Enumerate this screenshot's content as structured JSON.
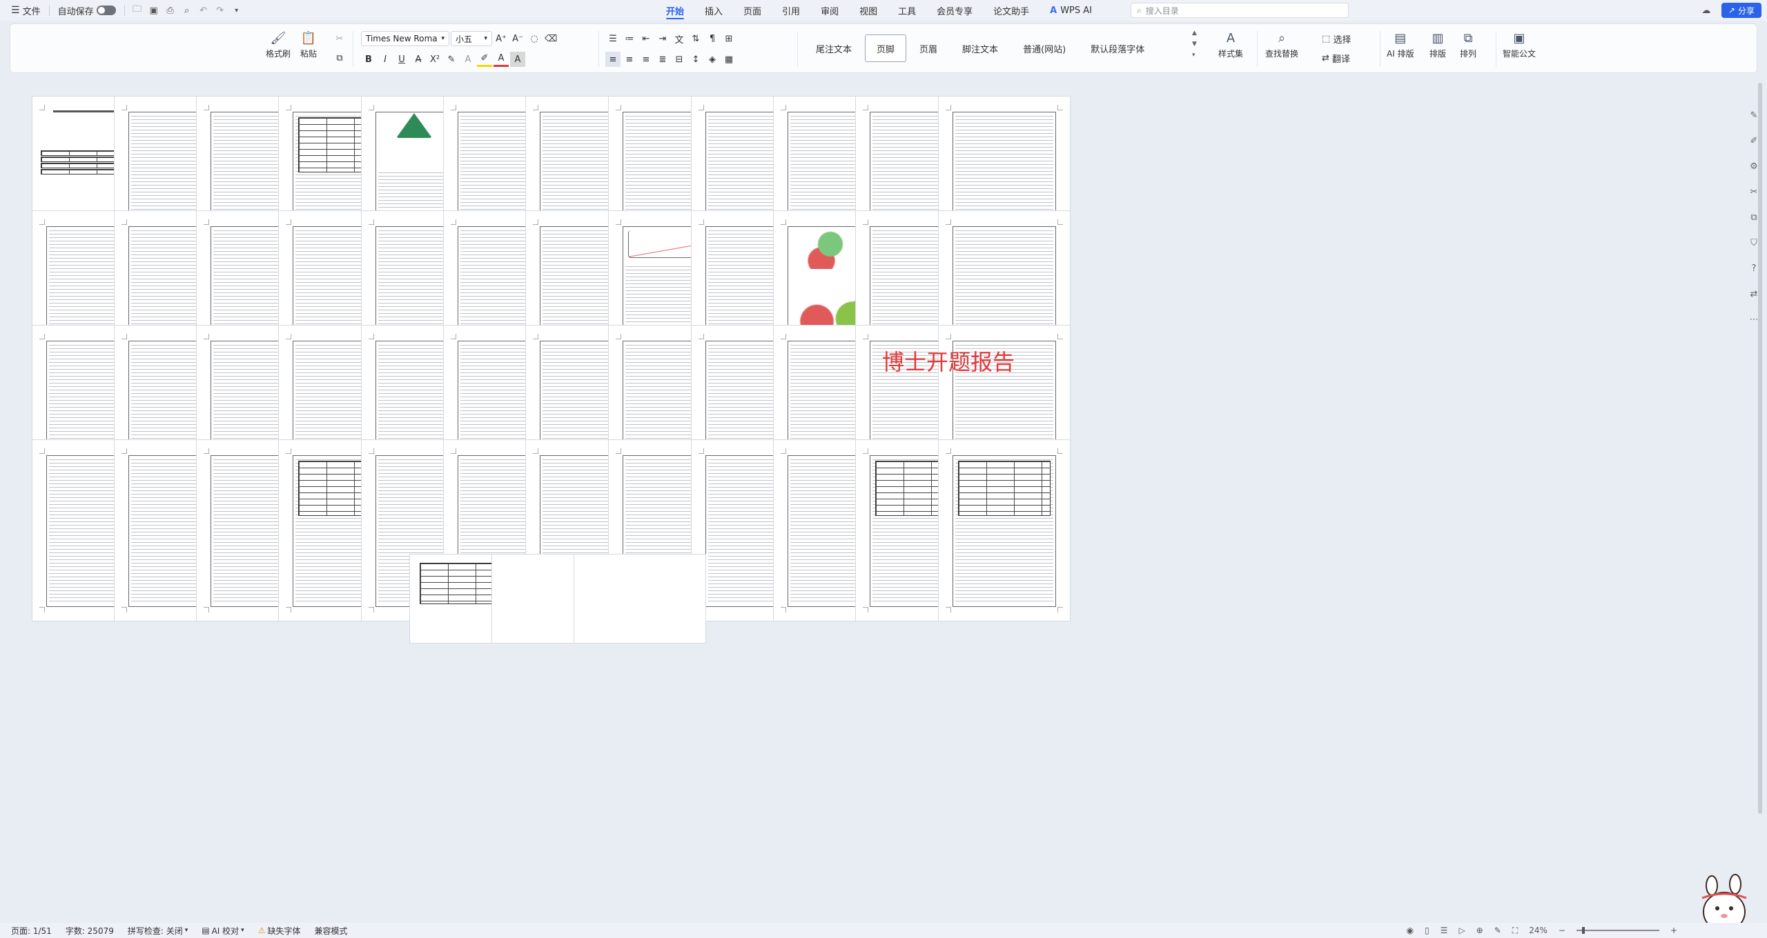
{
  "menubar": {
    "menu_icon": "menu-icon",
    "file_label": "文件",
    "autosave_label": "自动保存",
    "tabs": [
      "开始",
      "插入",
      "页面",
      "引用",
      "审阅",
      "视图",
      "工具",
      "会员专享",
      "论文助手",
      "WPS AI"
    ],
    "active_tab": "开始",
    "search_placeholder": "搜入目录",
    "share_label": "分享"
  },
  "ribbon": {
    "format_painter": "格式刷",
    "paste": "粘贴",
    "font_name": "Times New Roma",
    "font_size": "小五",
    "style_gallery": [
      "尾注文本",
      "页脚",
      "页眉",
      "脚注文本",
      "普通(网站)",
      "默认段落字体"
    ],
    "selected_style": "页脚",
    "style_set": "样式集",
    "find_replace": "查找替换",
    "select": "选择",
    "translate": "翻译",
    "ai_layout": "AI 排版",
    "layout": "排版",
    "arrange": "排列",
    "smart_doc": "智能公文",
    "colors": {
      "accent": "#2a62e8",
      "font_color": "#e03a3a",
      "highlight": "#f5d800"
    }
  },
  "document": {
    "watermark_text": "博士开题报告",
    "page_count": 51
  },
  "statusbar": {
    "page": "页面: 1/51",
    "words": "字数: 25079",
    "spell": "拼写检查: 关闭",
    "ai_check": "AI 校对",
    "missing_font": "缺失字体",
    "compat": "兼容模式",
    "zoom": "24%"
  }
}
